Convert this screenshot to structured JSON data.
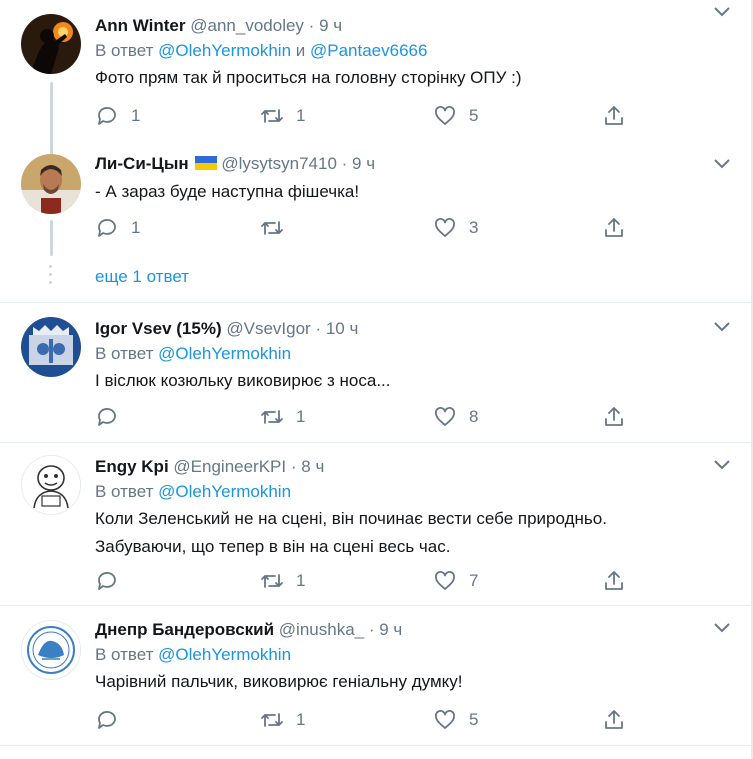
{
  "tweets": [
    {
      "name": "Ann Winter",
      "handle": "@ann_vodoley",
      "dot": "·",
      "time": "9 ч",
      "reply_prefix": "В ответ ",
      "reply_to_1": "@OlehYermokhin",
      "reply_join": " и ",
      "reply_to_2": "@Pantaev6666",
      "text": "Фото прям так й проситься на головну сторінку ОПУ :)",
      "replies": "1",
      "retweets": "1",
      "likes": "5"
    },
    {
      "name": "Ли-Си-Цын",
      "flag": "ukraine-flag",
      "handle": "@lysytsyn7410",
      "dot": "·",
      "time": "9 ч",
      "text": "- А зараз буде наступна фішечка!",
      "replies": "1",
      "retweets": "",
      "likes": "3"
    },
    {
      "name": "Igor Vsev (15%)",
      "handle": "@VsevIgor",
      "dot": "·",
      "time": "10 ч",
      "reply_prefix": "В ответ ",
      "reply_to_1": "@OlehYermokhin",
      "text": "І віслюк козюльку виковирює з носа...",
      "replies": "",
      "retweets": "1",
      "likes": "8"
    },
    {
      "name": "Engy Kpi",
      "handle": "@EngineerKPI",
      "dot": "·",
      "time": "8 ч",
      "reply_prefix": "В ответ ",
      "reply_to_1": "@OlehYermokhin",
      "text_line_1": "Коли Зеленський не на сцені, він починає вести себе природньо.",
      "text_line_2": "Забуваючи, що тепер в він на сцені весь час.",
      "replies": "",
      "retweets": "1",
      "likes": "7"
    },
    {
      "name": "Днепр Бандеровский",
      "handle": "@inushka_",
      "dot": "·",
      "time": "9 ч",
      "reply_prefix": "В ответ ",
      "reply_to_1": "@OlehYermokhin",
      "text": "Чарівний пальчик, виковирює геніальну думку!",
      "replies": "",
      "retweets": "1",
      "likes": "5"
    }
  ],
  "thread": {
    "more_replies": "еще 1 ответ"
  },
  "colors": {
    "link": "#1b95e0",
    "muted": "#657786",
    "text": "#14171a",
    "divider": "#e6ecf0"
  },
  "icons": [
    "reply-icon",
    "retweet-icon",
    "like-icon",
    "share-icon",
    "chevron-down-icon"
  ]
}
